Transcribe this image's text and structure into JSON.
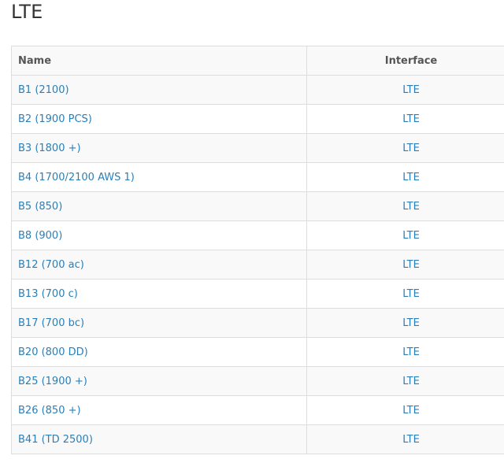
{
  "page": {
    "title": "LTE"
  },
  "table": {
    "headers": {
      "name": "Name",
      "interface": "Interface"
    },
    "rows": [
      {
        "name": "B1 (2100)",
        "interface": "LTE"
      },
      {
        "name": "B2 (1900 PCS)",
        "interface": "LTE"
      },
      {
        "name": "B3 (1800 +)",
        "interface": "LTE"
      },
      {
        "name": "B4 (1700/2100 AWS 1)",
        "interface": "LTE"
      },
      {
        "name": "B5 (850)",
        "interface": "LTE"
      },
      {
        "name": "B8 (900)",
        "interface": "LTE"
      },
      {
        "name": "B12 (700 ac)",
        "interface": "LTE"
      },
      {
        "name": "B13 (700 c)",
        "interface": "LTE"
      },
      {
        "name": "B17 (700 bc)",
        "interface": "LTE"
      },
      {
        "name": "B20 (800 DD)",
        "interface": "LTE"
      },
      {
        "name": "B25 (1900 +)",
        "interface": "LTE"
      },
      {
        "name": "B26 (850 +)",
        "interface": "LTE"
      },
      {
        "name": "B41 (TD 2500)",
        "interface": "LTE"
      }
    ]
  },
  "colors": {
    "link": "#2a7fb8",
    "header_text": "#555555",
    "title_text": "#333333",
    "border": "#dddddd",
    "stripe": "#f9f9f9"
  }
}
